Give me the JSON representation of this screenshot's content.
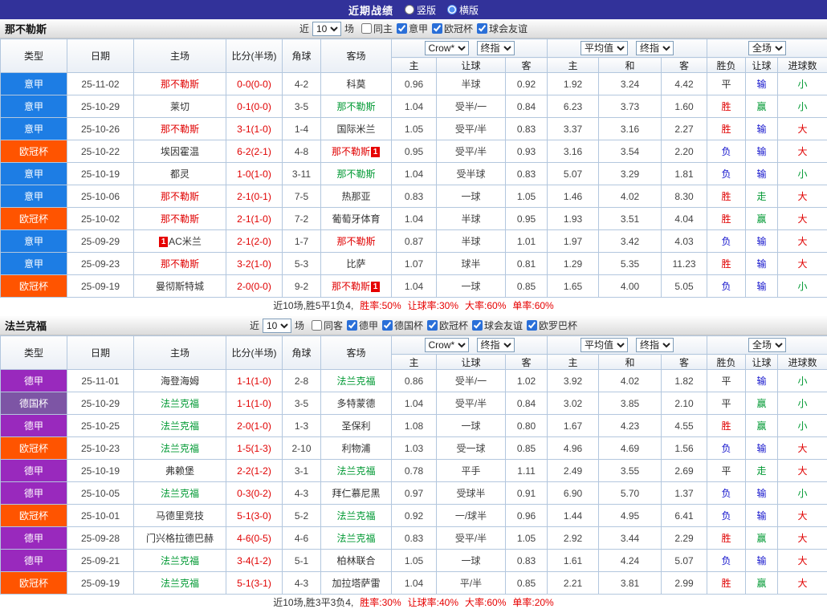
{
  "topbar": {
    "title": "近期战绩",
    "layout_options": [
      {
        "label": "竖版",
        "selected": false
      },
      {
        "label": "横版",
        "selected": true
      }
    ]
  },
  "table_header": {
    "col_type": "类型",
    "col_date": "日期",
    "col_home": "主场",
    "col_score": "比分(半场)",
    "col_corner": "角球",
    "col_away": "客场",
    "group1_select1": "Crow*",
    "group1_select2": "终指",
    "group1_cols": [
      "主",
      "让球",
      "客"
    ],
    "group2_select1": "平均值",
    "group2_select2": "终指",
    "group2_cols": [
      "主",
      "和",
      "客"
    ],
    "group3_select1": "全场",
    "group3_cols": [
      "胜负",
      "让球",
      "进球数"
    ]
  },
  "colors": {
    "league": {
      "意甲": "#1d7de4",
      "欧冠杯": "#ff5400",
      "德甲": "#9929bd",
      "德国杯": "#7d55a5"
    },
    "outcome": {
      "胜": "#e00000",
      "平": "#333333",
      "负": "#1414cc",
      "赢": "#009933",
      "输": "#1414cc",
      "走": "#009933",
      "大": "#e00000",
      "小": "#009933"
    },
    "team": {
      "red": "#e00000",
      "green": "#009933",
      "black": "#333333"
    },
    "score": "#e00000",
    "topbar_bg": "#32329a"
  },
  "sections": [
    {
      "team": "那不勒斯",
      "filter": {
        "near": "近",
        "games": "10",
        "games_suffix": "场",
        "checkboxes": [
          {
            "label": "同主",
            "checked": false
          },
          {
            "label": "意甲",
            "checked": true
          },
          {
            "label": "欧冠杯",
            "checked": true
          },
          {
            "label": "球会友谊",
            "checked": true
          }
        ]
      },
      "rows": [
        {
          "type": "意甲",
          "date": "25-11-02",
          "home": {
            "name": "那不勒斯",
            "color": "red"
          },
          "score": "0-0(0-0)",
          "corner": "4-2",
          "away": {
            "name": "科莫",
            "color": "black"
          },
          "odds": [
            "0.96",
            "半球",
            "0.92"
          ],
          "avg": [
            "1.92",
            "3.24",
            "4.42"
          ],
          "result": [
            "平",
            "输",
            "小"
          ]
        },
        {
          "type": "意甲",
          "date": "25-10-29",
          "home": {
            "name": "莱切",
            "color": "black"
          },
          "score": "0-1(0-0)",
          "corner": "3-5",
          "away": {
            "name": "那不勒斯",
            "color": "green"
          },
          "odds": [
            "1.04",
            "受半/一",
            "0.84"
          ],
          "avg": [
            "6.23",
            "3.73",
            "1.60"
          ],
          "result": [
            "胜",
            "赢",
            "小"
          ]
        },
        {
          "type": "意甲",
          "date": "25-10-26",
          "home": {
            "name": "那不勒斯",
            "color": "red"
          },
          "score": "3-1(1-0)",
          "corner": "1-4",
          "away": {
            "name": "国际米兰",
            "color": "black"
          },
          "odds": [
            "1.05",
            "受平/半",
            "0.83"
          ],
          "avg": [
            "3.37",
            "3.16",
            "2.27"
          ],
          "result": [
            "胜",
            "输",
            "大"
          ]
        },
        {
          "type": "欧冠杯",
          "date": "25-10-22",
          "home": {
            "name": "埃因霍温",
            "color": "black"
          },
          "score": "6-2(2-1)",
          "corner": "4-8",
          "away": {
            "name": "那不勒斯",
            "color": "red",
            "badge_after": "1"
          },
          "odds": [
            "0.95",
            "受平/半",
            "0.93"
          ],
          "avg": [
            "3.16",
            "3.54",
            "2.20"
          ],
          "result": [
            "负",
            "输",
            "大"
          ]
        },
        {
          "type": "意甲",
          "date": "25-10-19",
          "home": {
            "name": "都灵",
            "color": "black"
          },
          "score": "1-0(1-0)",
          "corner": "3-11",
          "away": {
            "name": "那不勒斯",
            "color": "green"
          },
          "odds": [
            "1.04",
            "受半球",
            "0.83"
          ],
          "avg": [
            "5.07",
            "3.29",
            "1.81"
          ],
          "result": [
            "负",
            "输",
            "小"
          ]
        },
        {
          "type": "意甲",
          "date": "25-10-06",
          "home": {
            "name": "那不勒斯",
            "color": "red"
          },
          "score": "2-1(0-1)",
          "corner": "7-5",
          "away": {
            "name": "热那亚",
            "color": "black"
          },
          "odds": [
            "0.83",
            "一球",
            "1.05"
          ],
          "avg": [
            "1.46",
            "4.02",
            "8.30"
          ],
          "result": [
            "胜",
            "走",
            "大"
          ]
        },
        {
          "type": "欧冠杯",
          "date": "25-10-02",
          "home": {
            "name": "那不勒斯",
            "color": "red"
          },
          "score": "2-1(1-0)",
          "corner": "7-2",
          "away": {
            "name": "葡萄牙体育",
            "color": "black"
          },
          "odds": [
            "1.04",
            "半球",
            "0.95"
          ],
          "avg": [
            "1.93",
            "3.51",
            "4.04"
          ],
          "result": [
            "胜",
            "赢",
            "大"
          ]
        },
        {
          "type": "意甲",
          "date": "25-09-29",
          "home": {
            "name": "AC米兰",
            "color": "black",
            "badge_before": "1"
          },
          "score": "2-1(2-0)",
          "corner": "1-7",
          "away": {
            "name": "那不勒斯",
            "color": "red"
          },
          "odds": [
            "0.87",
            "半球",
            "1.01"
          ],
          "avg": [
            "1.97",
            "3.42",
            "4.03"
          ],
          "result": [
            "负",
            "输",
            "大"
          ]
        },
        {
          "type": "意甲",
          "date": "25-09-23",
          "home": {
            "name": "那不勒斯",
            "color": "red"
          },
          "score": "3-2(1-0)",
          "corner": "5-3",
          "away": {
            "name": "比萨",
            "color": "black"
          },
          "odds": [
            "1.07",
            "球半",
            "0.81"
          ],
          "avg": [
            "1.29",
            "5.35",
            "11.23"
          ],
          "result": [
            "胜",
            "输",
            "大"
          ]
        },
        {
          "type": "欧冠杯",
          "date": "25-09-19",
          "home": {
            "name": "曼彻斯特城",
            "color": "black"
          },
          "score": "2-0(0-0)",
          "corner": "9-2",
          "away": {
            "name": "那不勒斯",
            "color": "red",
            "badge_after": "1"
          },
          "odds": [
            "1.04",
            "一球",
            "0.85"
          ],
          "avg": [
            "1.65",
            "4.00",
            "5.05"
          ],
          "result": [
            "负",
            "输",
            "小"
          ]
        }
      ],
      "summary": {
        "prefix": "近10场,胜5平1负4,",
        "stats": [
          "胜率:50%",
          "让球率:30%",
          "大率:60%",
          "单率:60%"
        ]
      }
    },
    {
      "team": "法兰克福",
      "filter": {
        "near": "近",
        "games": "10",
        "games_suffix": "场",
        "checkboxes": [
          {
            "label": "同客",
            "checked": false
          },
          {
            "label": "德甲",
            "checked": true
          },
          {
            "label": "德国杯",
            "checked": true
          },
          {
            "label": "欧冠杯",
            "checked": true
          },
          {
            "label": "球会友谊",
            "checked": true
          },
          {
            "label": "欧罗巴杯",
            "checked": true
          }
        ]
      },
      "rows": [
        {
          "type": "德甲",
          "date": "25-11-01",
          "home": {
            "name": "海登海姆",
            "color": "black"
          },
          "score": "1-1(1-0)",
          "corner": "2-8",
          "away": {
            "name": "法兰克福",
            "color": "green"
          },
          "odds": [
            "0.86",
            "受半/一",
            "1.02"
          ],
          "avg": [
            "3.92",
            "4.02",
            "1.82"
          ],
          "result": [
            "平",
            "输",
            "小"
          ]
        },
        {
          "type": "德国杯",
          "date": "25-10-29",
          "home": {
            "name": "法兰克福",
            "color": "green"
          },
          "score": "1-1(1-0)",
          "corner": "3-5",
          "away": {
            "name": "多特蒙德",
            "color": "black"
          },
          "odds": [
            "1.04",
            "受平/半",
            "0.84"
          ],
          "avg": [
            "3.02",
            "3.85",
            "2.10"
          ],
          "result": [
            "平",
            "赢",
            "小"
          ]
        },
        {
          "type": "德甲",
          "date": "25-10-25",
          "home": {
            "name": "法兰克福",
            "color": "green"
          },
          "score": "2-0(1-0)",
          "corner": "1-3",
          "away": {
            "name": "圣保利",
            "color": "black"
          },
          "odds": [
            "1.08",
            "一球",
            "0.80"
          ],
          "avg": [
            "1.67",
            "4.23",
            "4.55"
          ],
          "result": [
            "胜",
            "赢",
            "小"
          ]
        },
        {
          "type": "欧冠杯",
          "date": "25-10-23",
          "home": {
            "name": "法兰克福",
            "color": "green"
          },
          "score": "1-5(1-3)",
          "corner": "2-10",
          "away": {
            "name": "利物浦",
            "color": "black"
          },
          "odds": [
            "1.03",
            "受一球",
            "0.85"
          ],
          "avg": [
            "4.96",
            "4.69",
            "1.56"
          ],
          "result": [
            "负",
            "输",
            "大"
          ]
        },
        {
          "type": "德甲",
          "date": "25-10-19",
          "home": {
            "name": "弗赖堡",
            "color": "black"
          },
          "score": "2-2(1-2)",
          "corner": "3-1",
          "away": {
            "name": "法兰克福",
            "color": "green"
          },
          "odds": [
            "0.78",
            "平手",
            "1.11"
          ],
          "avg": [
            "2.49",
            "3.55",
            "2.69"
          ],
          "result": [
            "平",
            "走",
            "大"
          ]
        },
        {
          "type": "德甲",
          "date": "25-10-05",
          "home": {
            "name": "法兰克福",
            "color": "green"
          },
          "score": "0-3(0-2)",
          "corner": "4-3",
          "away": {
            "name": "拜仁慕尼黑",
            "color": "black"
          },
          "odds": [
            "0.97",
            "受球半",
            "0.91"
          ],
          "avg": [
            "6.90",
            "5.70",
            "1.37"
          ],
          "result": [
            "负",
            "输",
            "小"
          ]
        },
        {
          "type": "欧冠杯",
          "date": "25-10-01",
          "home": {
            "name": "马德里竞技",
            "color": "black"
          },
          "score": "5-1(3-0)",
          "corner": "5-2",
          "away": {
            "name": "法兰克福",
            "color": "green"
          },
          "odds": [
            "0.92",
            "一/球半",
            "0.96"
          ],
          "avg": [
            "1.44",
            "4.95",
            "6.41"
          ],
          "result": [
            "负",
            "输",
            "大"
          ]
        },
        {
          "type": "德甲",
          "date": "25-09-28",
          "home": {
            "name": "门兴格拉德巴赫",
            "color": "black"
          },
          "score": "4-6(0-5)",
          "corner": "4-6",
          "away": {
            "name": "法兰克福",
            "color": "green"
          },
          "odds": [
            "0.83",
            "受平/半",
            "1.05"
          ],
          "avg": [
            "2.92",
            "3.44",
            "2.29"
          ],
          "result": [
            "胜",
            "赢",
            "大"
          ]
        },
        {
          "type": "德甲",
          "date": "25-09-21",
          "home": {
            "name": "法兰克福",
            "color": "green"
          },
          "score": "3-4(1-2)",
          "corner": "5-1",
          "away": {
            "name": "柏林联合",
            "color": "black"
          },
          "odds": [
            "1.05",
            "一球",
            "0.83"
          ],
          "avg": [
            "1.61",
            "4.24",
            "5.07"
          ],
          "result": [
            "负",
            "输",
            "大"
          ]
        },
        {
          "type": "欧冠杯",
          "date": "25-09-19",
          "home": {
            "name": "法兰克福",
            "color": "green"
          },
          "score": "5-1(3-1)",
          "corner": "4-3",
          "away": {
            "name": "加拉塔萨雷",
            "color": "black"
          },
          "odds": [
            "1.04",
            "平/半",
            "0.85"
          ],
          "avg": [
            "2.21",
            "3.81",
            "2.99"
          ],
          "result": [
            "胜",
            "赢",
            "大"
          ]
        }
      ],
      "summary": {
        "prefix": "近10场,胜3平3负4,",
        "stats": [
          "胜率:30%",
          "让球率:40%",
          "大率:60%",
          "单率:20%"
        ]
      }
    }
  ]
}
